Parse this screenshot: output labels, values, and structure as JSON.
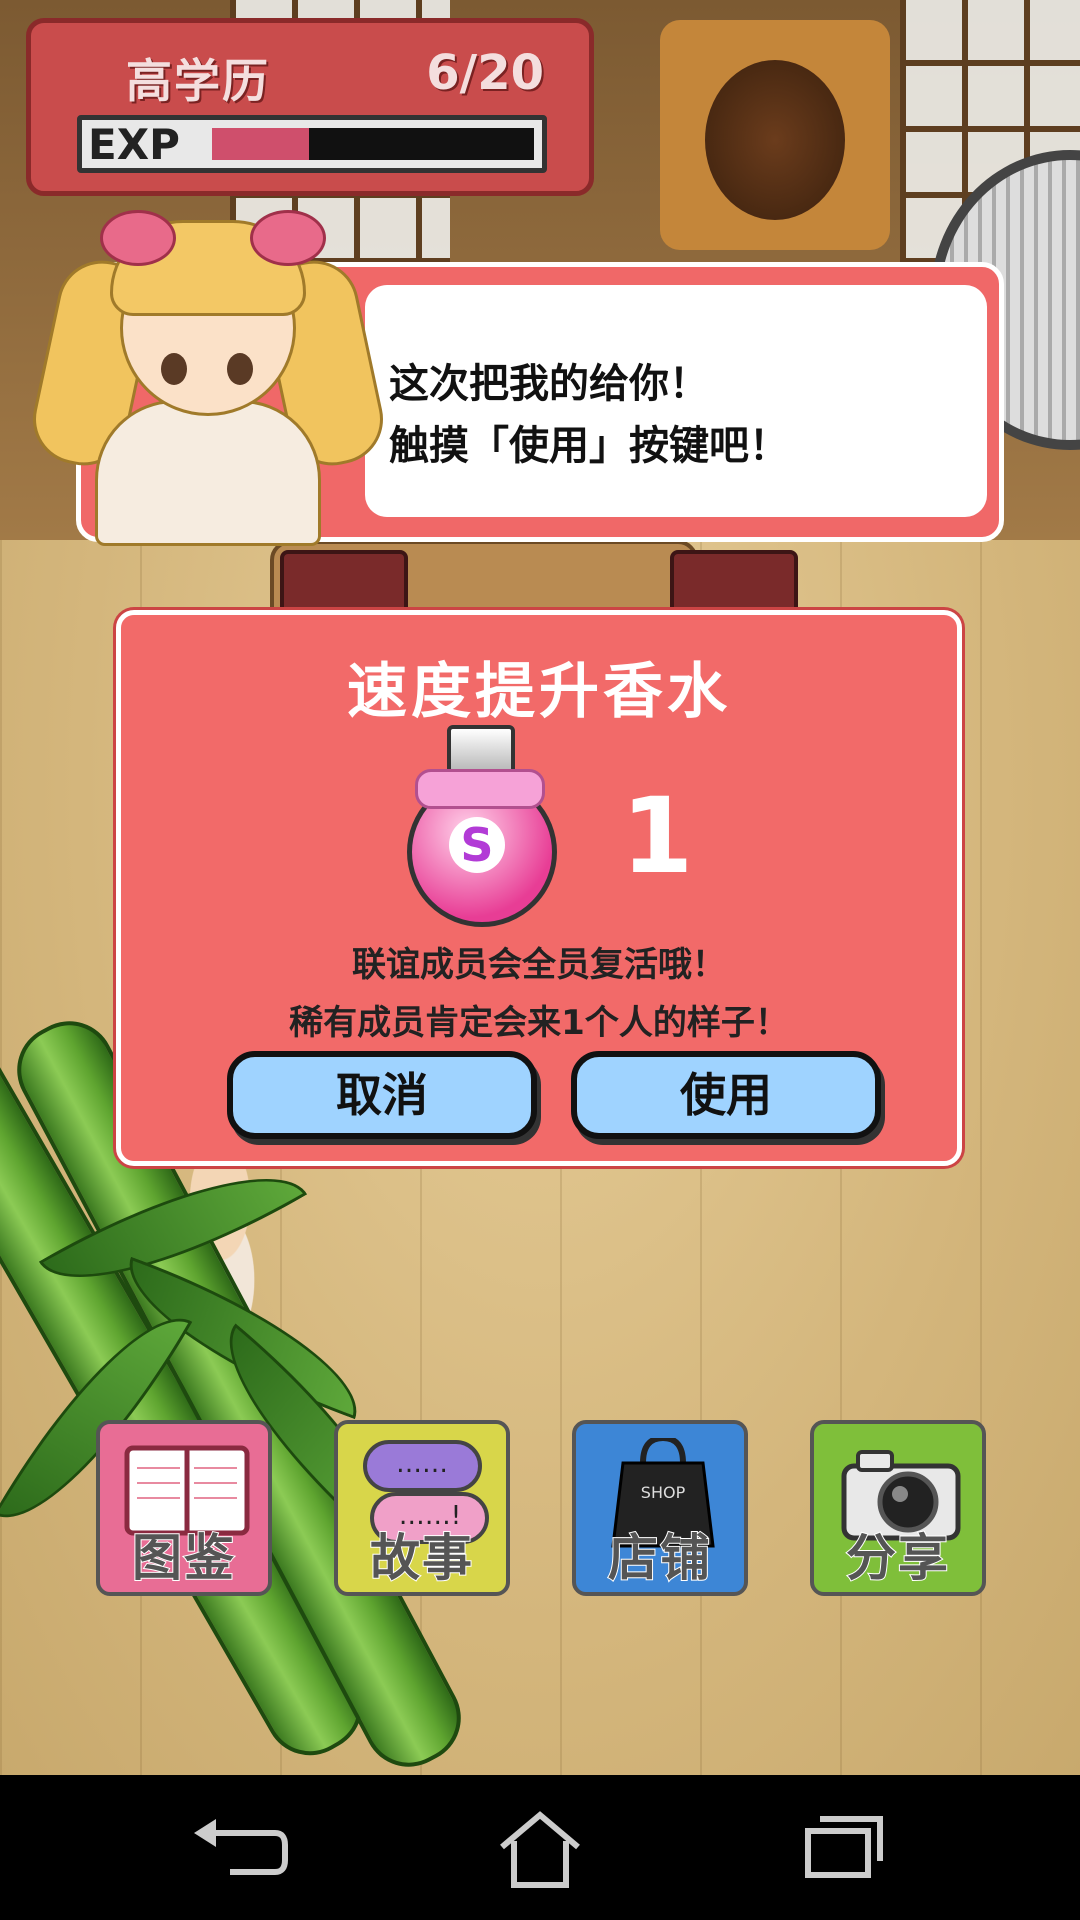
{
  "level": {
    "title": "高学历",
    "count": "6/20",
    "exp_label": "EXP",
    "exp_progress": 0.3
  },
  "speech": {
    "line1": "这次把我的给你！",
    "line2": "触摸「使用」按键吧！"
  },
  "item_dialog": {
    "title": "速度提升香水",
    "badge": "S",
    "count": "1",
    "desc1": "联谊成员会全员复活哦！",
    "desc2": "稀有成员肯定会来1个人的样子！",
    "cancel_label": "取消",
    "use_label": "使用"
  },
  "menu": {
    "items": [
      {
        "label": "图鉴",
        "icon": "book-icon",
        "color": "#e86d95"
      },
      {
        "label": "故事",
        "icon": "speech-bubbles-icon",
        "color": "#d8d64a"
      },
      {
        "label": "店铺",
        "icon": "shopping-bag-icon",
        "color": "#3d86d6"
      },
      {
        "label": "分享",
        "icon": "camera-icon",
        "color": "#7fbf3a"
      }
    ],
    "shop_bag_text": "SHOP",
    "story_dots_1": "……",
    "story_dots_2": "……!"
  },
  "navbar": {
    "icons": [
      "back-icon",
      "home-icon",
      "recent-apps-icon"
    ]
  }
}
